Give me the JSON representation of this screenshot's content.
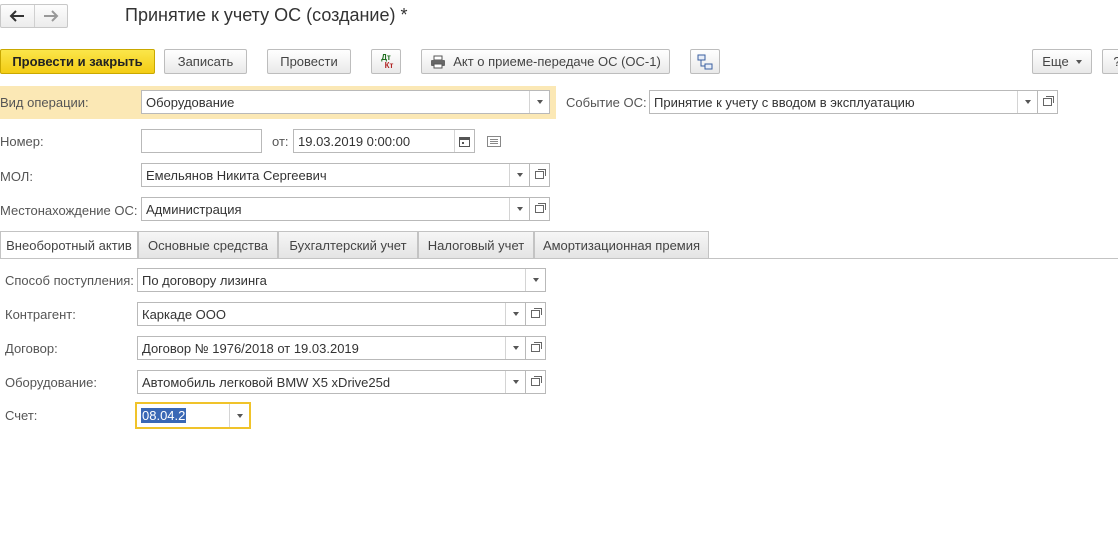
{
  "window": {
    "title": "Принятие к учету ОС (создание) *"
  },
  "toolbar": {
    "post_close": "Провести и закрыть",
    "save": "Записать",
    "post": "Провести",
    "dtkt_top": "Дт",
    "dtkt_bottom": "Кт",
    "act": "Акт о приеме-передаче ОС (ОС-1)",
    "more": "Еще",
    "help": "?"
  },
  "header": {
    "operation_label": "Вид операции:",
    "operation_value": "Оборудование",
    "event_label": "Событие ОС:",
    "event_value": "Принятие к учету с вводом в эксплуатацию",
    "number_label": "Номер:",
    "number_value": "",
    "date_label": "от:",
    "date_value": "19.03.2019  0:00:00",
    "mol_label": "МОЛ:",
    "mol_value": "Емельянов Никита Сергеевич",
    "location_label": "Местонахождение ОС:",
    "location_value": "Администрация"
  },
  "tabs": [
    {
      "label": "Внеоборотный актив",
      "active": true
    },
    {
      "label": "Основные средства",
      "active": false
    },
    {
      "label": "Бухгалтерский учет",
      "active": false
    },
    {
      "label": "Налоговый учет",
      "active": false
    },
    {
      "label": "Амортизационная премия",
      "active": false
    }
  ],
  "asset": {
    "receipt_label": "Способ поступления:",
    "receipt_value": "По договору лизинга",
    "contractor_label": "Контрагент:",
    "contractor_value": "Каркаде ООО",
    "contract_label": "Договор:",
    "contract_value": "Договор № 1976/2018 от 19.03.2019",
    "equipment_label": "Оборудование:",
    "equipment_value": "Автомобиль легковой BMW X5 xDrive25d",
    "account_label": "Счет:",
    "account_value": "08.04.2"
  },
  "colors": {
    "primary_button": "#f3cc14",
    "highlight_band": "#fbe8b5",
    "focus_border": "#f0c32a",
    "selection": "#3a68b5"
  }
}
